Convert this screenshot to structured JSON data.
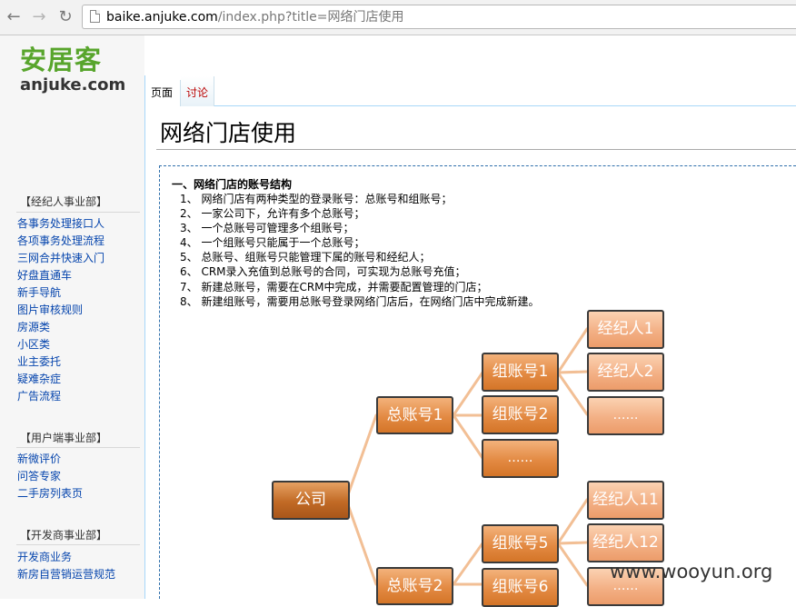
{
  "browser": {
    "url_host": "baike.anjuke.com",
    "url_path": "/index.php?title=网络门店使用",
    "back_icon": "arrow-left-icon",
    "forward_icon": "arrow-right-icon",
    "reload_icon": "reload-icon"
  },
  "logo": {
    "cn": "安居客",
    "en": "anjuke.com",
    "color": "#58a52c"
  },
  "sidebar": {
    "portals": [
      {
        "heading": "【经纪人事业部】",
        "items": [
          "各事务处理接口人",
          "各项事务处理流程",
          "三网合并快速入门",
          "好盘直通车",
          "新手导航",
          "图片审核规则",
          "房源类",
          "小区类",
          "业主委托",
          "疑难杂症",
          "广告流程"
        ]
      },
      {
        "heading": "【用户端事业部】",
        "items": [
          "新微评价",
          "问答专家",
          "二手房列表页"
        ]
      },
      {
        "heading": "【开发商事业部】",
        "items": [
          "开发商业务",
          "新房自营销运营规范"
        ]
      }
    ]
  },
  "tabs": {
    "page": "页面",
    "talk": "讨论"
  },
  "article": {
    "title": "网络门店使用",
    "section_title": "一、网络门店的账号结构",
    "items": [
      "1、 网络门店有两种类型的登录账号：总账号和组账号；",
      "2、 一家公司下，允许有多个总账号；",
      "3、 一个总账号可管理多个组账号；",
      "4、 一个组账号只能属于一个总账号；",
      "5、 总账号、组账号只能管理下属的账号和经纪人；",
      "6、 CRM录入充值到总账号的合同，可实现为总账号充值；",
      "7、 新建总账号，需要在CRM中完成，并需要配置管理的门店；",
      "8、 新建组账号，需要用总账号登录网络门店后，在网络门店中完成新建。"
    ]
  },
  "diagram": {
    "company": "公司",
    "master1": "总账号1",
    "master2": "总账号2",
    "group1": "组账号1",
    "group2": "组账号2",
    "group_more": "……",
    "group5": "组账号5",
    "group6": "组账号6",
    "agent1": "经纪人1",
    "agent2": "经纪人2",
    "agent_more": "……",
    "agent11": "经纪人11",
    "agent12": "经纪人12",
    "colors": {
      "dark": "#c16a25",
      "mid": "#e38a43",
      "light": "#f3b085",
      "connector": "#f2bf95"
    }
  },
  "watermark": "www.wooyun.org"
}
